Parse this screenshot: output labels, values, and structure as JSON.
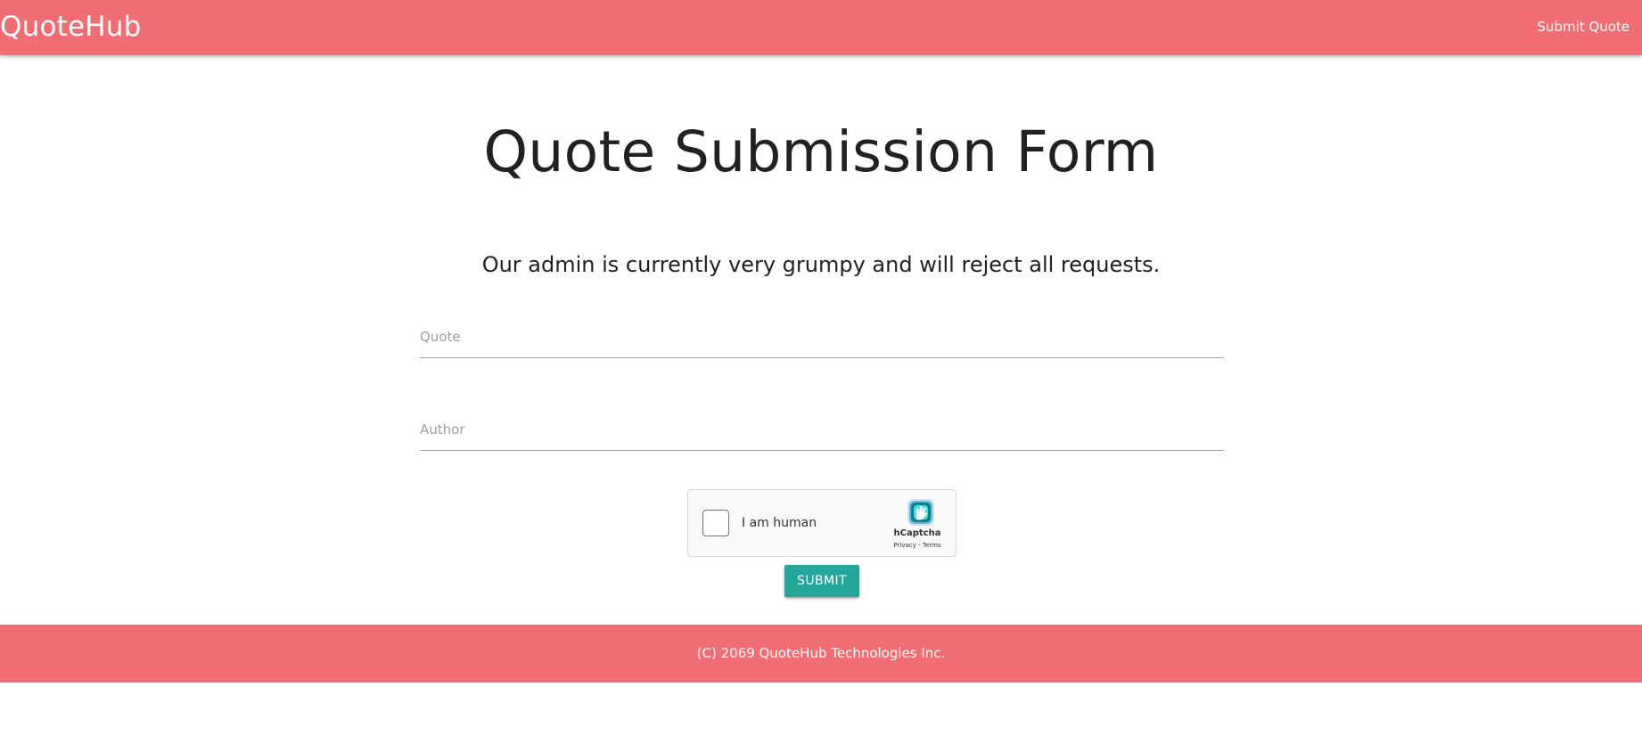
{
  "colors": {
    "brand": "#f06e73",
    "accent": "#26a69a",
    "text": "#212121",
    "placeholder": "#9e9e9e"
  },
  "navbar": {
    "brand": "QuoteHub",
    "links": [
      {
        "label": "Submit Quote"
      }
    ]
  },
  "main": {
    "title": "Quote Submission Form",
    "subtitle": "Our admin is currently very grumpy and will reject all requests.",
    "form": {
      "quote": {
        "value": "",
        "placeholder": "Quote"
      },
      "author": {
        "value": "",
        "placeholder": "Author"
      },
      "captcha": {
        "checkbox_checked": false,
        "label": "I am human",
        "brand": "hCaptcha",
        "privacy_link": "Privacy",
        "separator": " - ",
        "terms_link": "Terms",
        "logo_icon": "hcaptcha-logo-icon"
      },
      "submit_label": "Submit"
    }
  },
  "footer": {
    "copyright": "(C) 2069 QuoteHub Technologies Inc."
  }
}
